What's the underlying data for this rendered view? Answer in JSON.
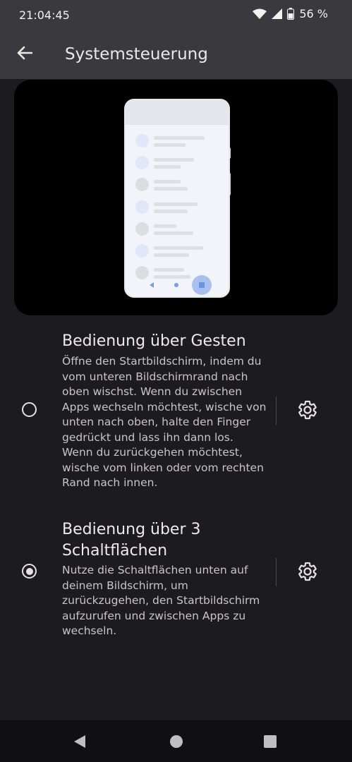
{
  "status": {
    "time": "21:04:45",
    "battery": "56 %",
    "icons": [
      "wifi-icon",
      "signal-icon",
      "battery-icon"
    ]
  },
  "appbar": {
    "title": "Systemsteuerung",
    "back_icon": "arrow-back-icon"
  },
  "options": [
    {
      "title": "Bedienung über Gesten",
      "description": "Öffne den Startbildschirm, indem du vom unteren Bildschirmrand nach oben wischst. Wenn du zwischen Apps wechseln möchtest, wische von unten nach oben, halte den Finger gedrückt und lass ihn dann los. Wenn du zurückgehen möchtest, wische vom linken oder vom rechten Rand nach innen.",
      "selected": false,
      "settings_icon": "gear-icon"
    },
    {
      "title": "Bedienung über 3 Schaltflächen",
      "description": "Nutze die Schaltflächen unten auf deinem Bildschirm, um zurückzugehen, den Startbildschirm aufzurufen und zwischen Apps zu wechseln.",
      "selected": true,
      "settings_icon": "gear-icon"
    }
  ],
  "colors": {
    "background": "#1c1b20",
    "appbar": "#3a393d",
    "accent_preview": "#a8c0f0"
  },
  "navbar": {
    "icons": [
      "nav-back-icon",
      "nav-home-icon",
      "nav-recents-icon"
    ]
  }
}
